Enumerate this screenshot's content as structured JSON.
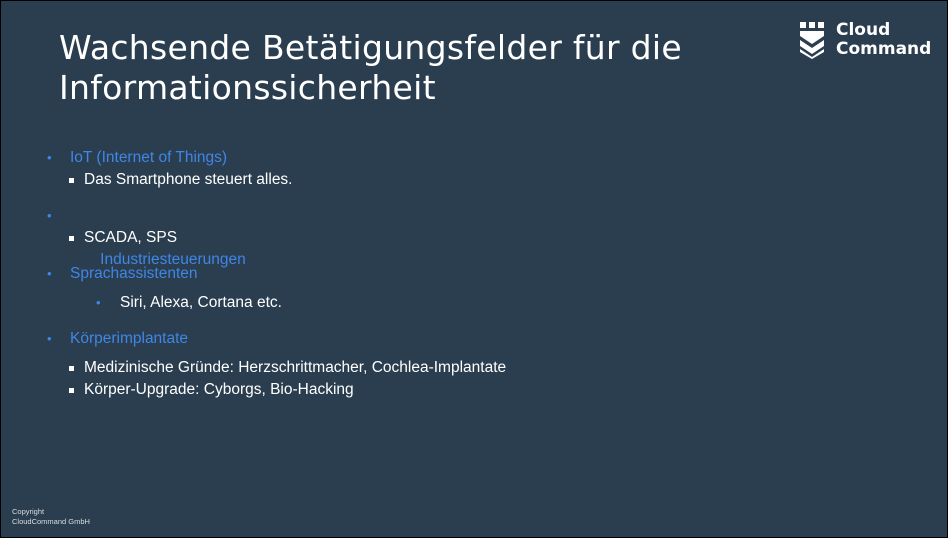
{
  "slide": {
    "title_line1": "Wachsende Betätigungsfelder für die",
    "title_line2": "Informationssicherheit"
  },
  "logo": {
    "line1": "Cloud",
    "line2": "Command",
    "icon": "shield-chevron-logo"
  },
  "bullets": [
    {
      "label": "IoT (Internet of Things)",
      "subs": [
        "Das Smartphone steuert alles."
      ]
    },
    {
      "label": " Industriesteuerungen",
      "subs": [
        "SCADA, SPS"
      ]
    },
    {
      "label": "Sprachassistenten",
      "subs": [
        "Siri, Alexa, Cortana etc."
      ]
    },
    {
      "label": "Körperimplantate",
      "subs": [
        "Medizinische Gründe: Herzschrittmacher, Cochlea-Implantate",
        "Körper-Upgrade: Cyborgs, Bio-Hacking"
      ]
    }
  ],
  "footer": {
    "line1": "Copyright",
    "line2": "CloudCommand GmbH"
  },
  "colors": {
    "background": "#2b3e4f",
    "accent": "#3f86e6",
    "text": "#ffffff"
  }
}
